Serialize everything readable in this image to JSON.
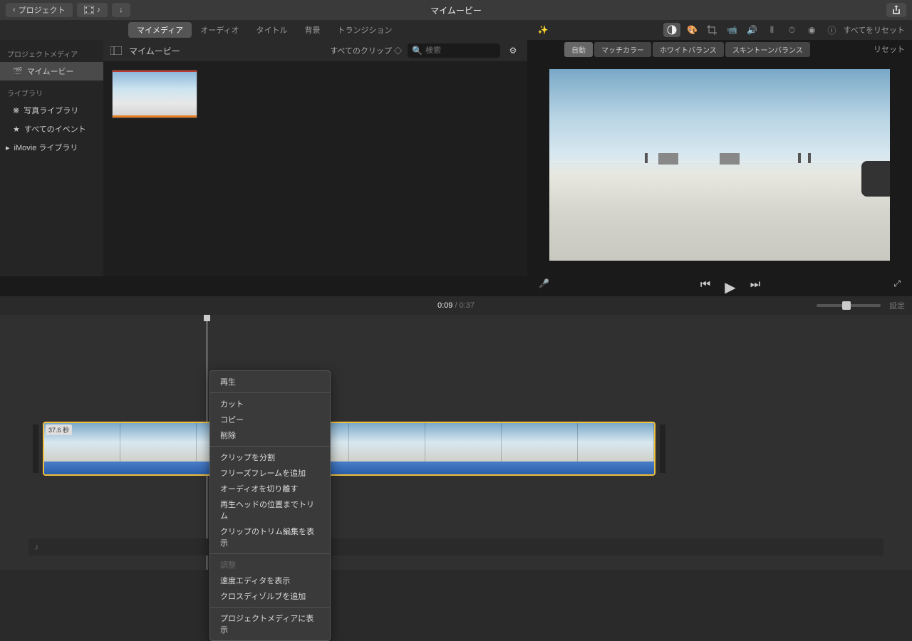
{
  "titlebar": {
    "back_label": "プロジェクト",
    "title": "マイムービー"
  },
  "tabs": {
    "mymedia": "マイメディア",
    "audio": "オーディオ",
    "titles": "タイトル",
    "backgrounds": "背景",
    "transitions": "トランジション"
  },
  "sidebar": {
    "project_media_header": "プロジェクトメディア",
    "mymovie": "マイムービー",
    "library_header": "ライブラリ",
    "photo_library": "写真ライブラリ",
    "all_events": "すべてのイベント",
    "imovie_library": "iMovie ライブラリ"
  },
  "media": {
    "title": "マイムービー",
    "filter": "すべてのクリップ",
    "search_placeholder": "検索"
  },
  "inspector": {
    "reset_all": "すべてをリセット",
    "auto": "自動",
    "match_color": "マッチカラー",
    "white_balance": "ホワイトバランス",
    "skin_balance": "スキントーンバランス",
    "reset": "リセット"
  },
  "time": {
    "current": "0:09",
    "total": "0:37",
    "settings": "設定"
  },
  "clip": {
    "duration_badge": "37.6 秒"
  },
  "context_menu": {
    "play": "再生",
    "cut": "カット",
    "copy": "コピー",
    "delete": "削除",
    "split": "クリップを分割",
    "freeze_frame": "フリーズフレームを追加",
    "detach_audio": "オーディオを切り離す",
    "trim_to_playhead": "再生ヘッドの位置までトリム",
    "show_trim_editor": "クリップのトリム編集を表示",
    "adjust": "調整",
    "speed_editor": "速度エディタを表示",
    "cross_dissolve": "クロスディゾルブを追加",
    "reveal_in_media": "プロジェクトメディアに表示"
  }
}
